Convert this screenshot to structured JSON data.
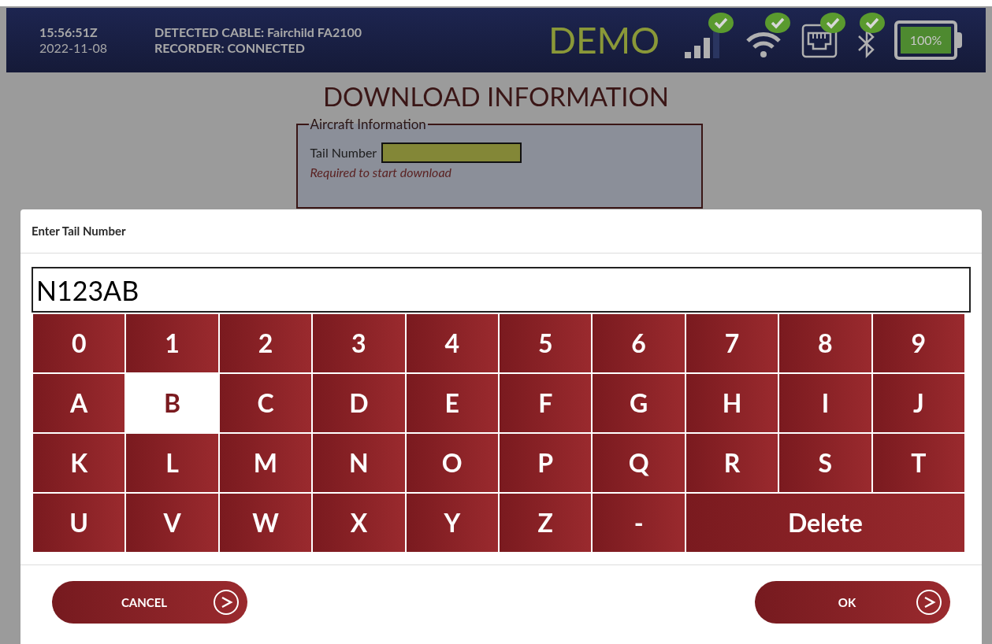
{
  "status_bar": {
    "time": "15:56:51Z",
    "date": "2022-11-08",
    "cable": "DETECTED CABLE: Fairchild FA2100",
    "recorder": "RECORDER: CONNECTED",
    "mode": "DEMO",
    "indicators": [
      {
        "kind": "cellular",
        "ok": true
      },
      {
        "kind": "wifi",
        "ok": true
      },
      {
        "kind": "ethernet",
        "ok": true
      },
      {
        "kind": "bluetooth",
        "ok": true
      }
    ],
    "battery": {
      "level": 1,
      "text": "100%"
    }
  },
  "page": {
    "title": "DOWNLOAD INFORMATION",
    "fieldset": {
      "legend": "Aircraft Information",
      "label": "Tail Number",
      "hint": "Required to start download"
    }
  },
  "dialog": {
    "title": "Enter Tail Number",
    "value": "N123AB",
    "keys": [
      {
        "label": "0",
        "kind": "single",
        "selected": false
      },
      {
        "label": "1",
        "kind": "single",
        "selected": false
      },
      {
        "label": "2",
        "kind": "single",
        "selected": false
      },
      {
        "label": "3",
        "kind": "single",
        "selected": false
      },
      {
        "label": "4",
        "kind": "single",
        "selected": false
      },
      {
        "label": "5",
        "kind": "single",
        "selected": false
      },
      {
        "label": "6",
        "kind": "single",
        "selected": false
      },
      {
        "label": "7",
        "kind": "single",
        "selected": false
      },
      {
        "label": "8",
        "kind": "single",
        "selected": false
      },
      {
        "label": "9",
        "kind": "single",
        "selected": false
      },
      {
        "label": "A",
        "kind": "single",
        "selected": false
      },
      {
        "label": "B",
        "kind": "single",
        "selected": true
      },
      {
        "label": "C",
        "kind": "single",
        "selected": false
      },
      {
        "label": "D",
        "kind": "single",
        "selected": false
      },
      {
        "label": "E",
        "kind": "single",
        "selected": false
      },
      {
        "label": "F",
        "kind": "single",
        "selected": false
      },
      {
        "label": "G",
        "kind": "single",
        "selected": false
      },
      {
        "label": "H",
        "kind": "single",
        "selected": false
      },
      {
        "label": "I",
        "kind": "single",
        "selected": false
      },
      {
        "label": "J",
        "kind": "single",
        "selected": false
      },
      {
        "label": "K",
        "kind": "single",
        "selected": false
      },
      {
        "label": "L",
        "kind": "single",
        "selected": false
      },
      {
        "label": "M",
        "kind": "single",
        "selected": false
      },
      {
        "label": "N",
        "kind": "single",
        "selected": false
      },
      {
        "label": "O",
        "kind": "single",
        "selected": false
      },
      {
        "label": "P",
        "kind": "single",
        "selected": false
      },
      {
        "label": "Q",
        "kind": "single",
        "selected": false
      },
      {
        "label": "R",
        "kind": "single",
        "selected": false
      },
      {
        "label": "S",
        "kind": "single",
        "selected": false
      },
      {
        "label": "T",
        "kind": "single",
        "selected": false
      },
      {
        "label": "U",
        "kind": "single",
        "selected": false
      },
      {
        "label": "V",
        "kind": "single",
        "selected": false
      },
      {
        "label": "W",
        "kind": "single",
        "selected": false
      },
      {
        "label": "X",
        "kind": "single",
        "selected": false
      },
      {
        "label": "Y",
        "kind": "single",
        "selected": false
      },
      {
        "label": "Z",
        "kind": "single",
        "selected": false
      },
      {
        "label": "-",
        "kind": "single",
        "selected": false
      },
      {
        "label": "Delete",
        "kind": "wide",
        "selected": false
      }
    ],
    "buttons": [
      {
        "label": "CANCEL"
      },
      {
        "label": "OK"
      }
    ]
  }
}
